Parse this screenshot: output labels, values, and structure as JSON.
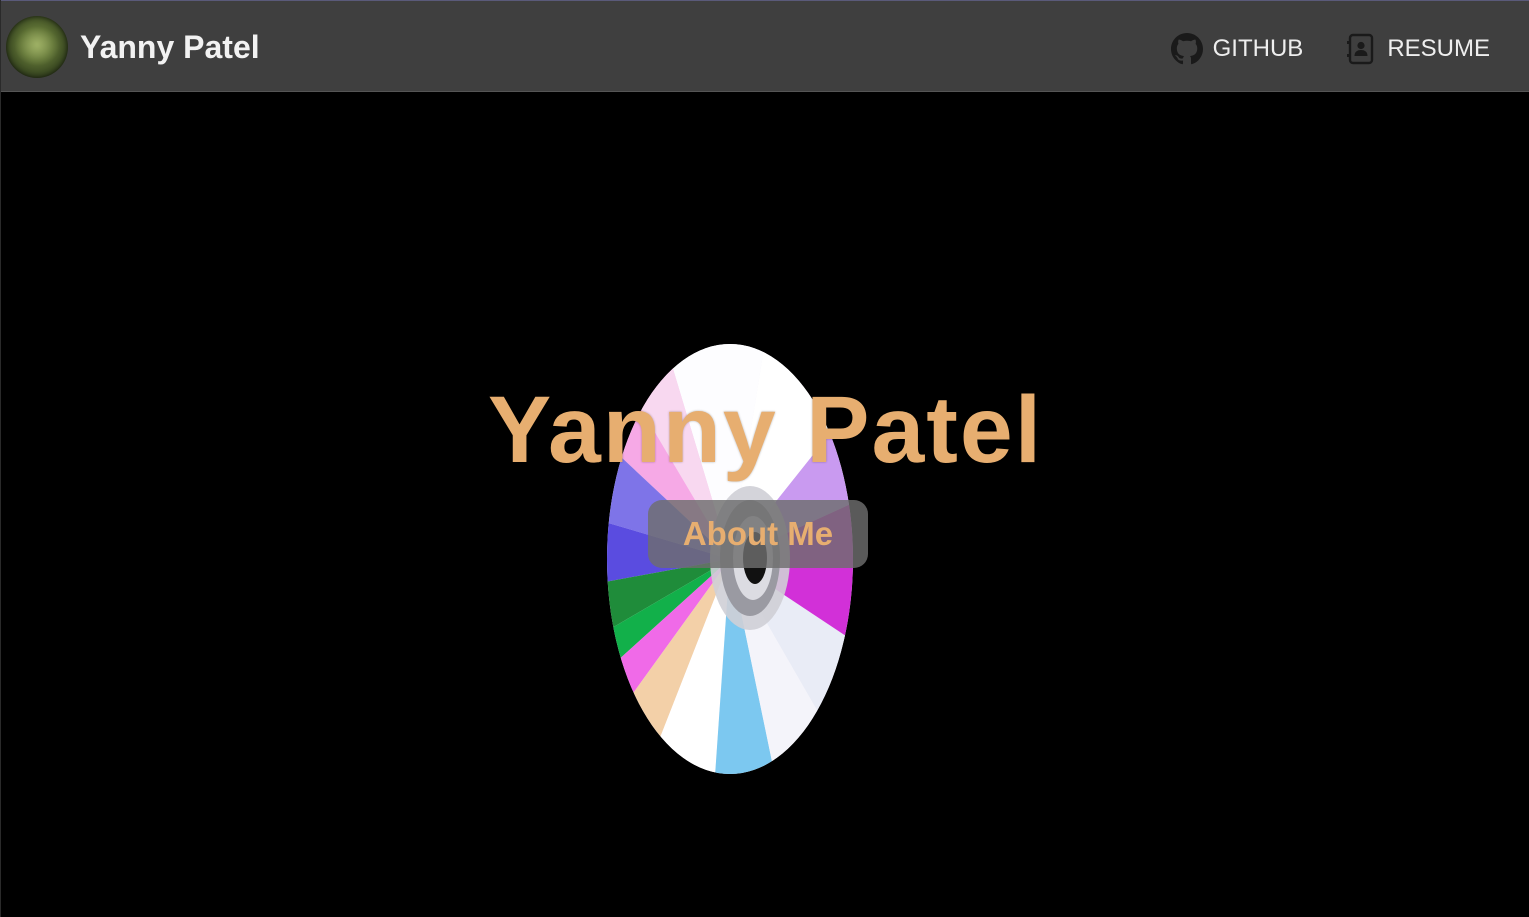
{
  "navbar": {
    "brand_name": "Yanny Patel",
    "links": [
      {
        "label": "GITHUB",
        "icon": "github-icon"
      },
      {
        "label": "RESUME",
        "icon": "resume-icon"
      }
    ]
  },
  "hero": {
    "title": "Yanny Patel",
    "button_label": "About Me"
  },
  "colors": {
    "navbar_bg": "#3f3f3f",
    "page_bg": "#000000",
    "accent": "#e7ae70",
    "nav_text": "#eeeeee"
  }
}
